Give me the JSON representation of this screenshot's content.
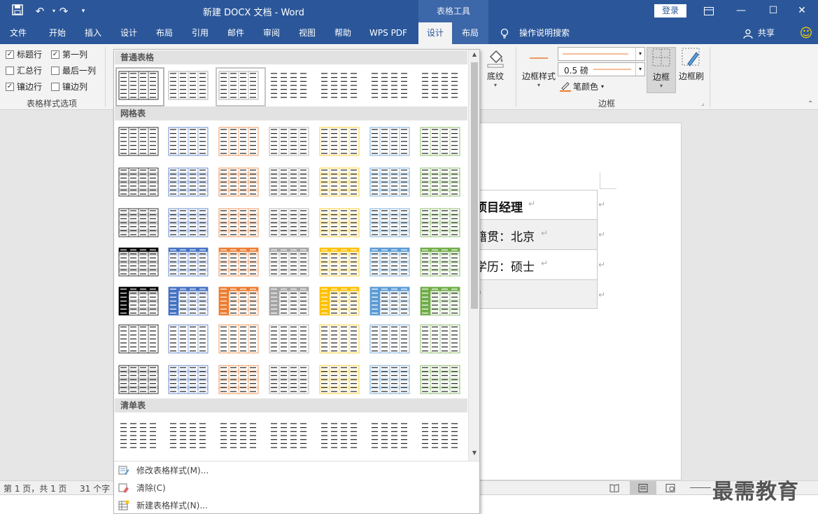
{
  "title": {
    "doc_title": "新建 DOCX 文档  -  Word",
    "table_tools": "表格工具",
    "login": "登录",
    "share": "共享",
    "smiley": "☺"
  },
  "tabs": [
    "文件",
    "开始",
    "插入",
    "设计",
    "布局",
    "引用",
    "邮件",
    "审阅",
    "视图",
    "帮助",
    "WPS PDF",
    "设计",
    "布局"
  ],
  "tell_me": "操作说明搜索",
  "ribbon": {
    "style_options": {
      "header_row": "标题行",
      "first_column": "第一列",
      "total_row": "汇总行",
      "last_column": "最后一列",
      "banded_rows": "镶边行",
      "banded_columns": "镶边列",
      "group_label": "表格样式选项"
    },
    "shading": "底纹",
    "border_styles": "边框样式",
    "pen_weight": "0.5 磅",
    "pen_color": "笔颜色",
    "borders": "边框",
    "border_painter": "边框刷",
    "borders_group": "边框"
  },
  "gallery": {
    "plain_tables": "普通表格",
    "grid_tables": "网格表",
    "list_tables": "清单表",
    "modify_style": "修改表格样式(M)...",
    "clear": "清除(C)",
    "new_style": "新建表格样式(N)..."
  },
  "document": {
    "rows": [
      "项目经理",
      "籍贯：北京",
      "学历：硕士",
      ""
    ],
    "cell_rows_visible": [
      "项目经理",
      "籍贯：北京",
      "学历：硕士"
    ]
  },
  "status": {
    "page": "第 1 页，共 1 页",
    "words": "31 个字"
  },
  "watermark": "最需教育",
  "colors": {
    "brand": "#2b579a",
    "accent_palette": [
      "#000000",
      "#4472c4",
      "#ed7d31",
      "#a5a5a5",
      "#ffc000",
      "#5b9bd5",
      "#70ad47"
    ]
  }
}
